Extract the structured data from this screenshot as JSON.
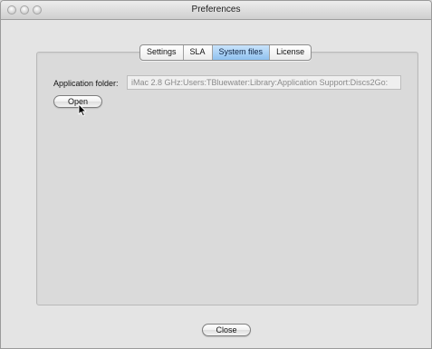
{
  "window": {
    "title": "Preferences"
  },
  "tabs": [
    {
      "label": "Settings",
      "selected": false
    },
    {
      "label": "SLA",
      "selected": false
    },
    {
      "label": "System files",
      "selected": true
    },
    {
      "label": "License",
      "selected": false
    }
  ],
  "system_files": {
    "application_folder_label": "Application folder:",
    "application_folder_path": "iMac 2.8 GHz:Users:TBluewater:Library:Application Support:Discs2Go:",
    "open_button_label": "Open"
  },
  "footer": {
    "close_button_label": "Close"
  },
  "colors": {
    "selected_tab": "#8fc1ef",
    "window_bg": "#e4e4e4"
  },
  "icons": {
    "cursor": "arrow-cursor-icon"
  }
}
